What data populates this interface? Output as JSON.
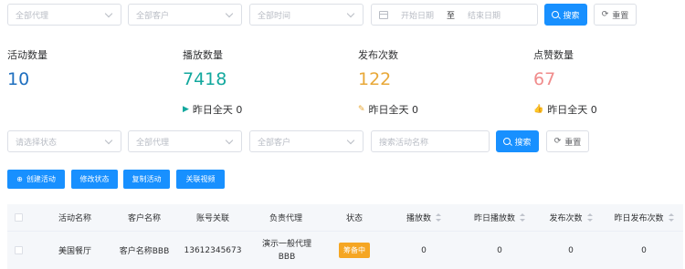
{
  "filters_top": {
    "agent_placeholder": "全部代理",
    "customer_placeholder": "全部客户",
    "time_placeholder": "全部时间",
    "start_date_placeholder": "开始日期",
    "date_separator": "至",
    "end_date_placeholder": "结束日期",
    "search_label": "搜索",
    "reset_label": "重置"
  },
  "stats": {
    "activity_count_label": "活动数量",
    "activity_count_value": "10",
    "play_count_label": "播放数量",
    "play_count_value": "7418",
    "play_yesterday": "昨日全天 0",
    "publish_count_label": "发布次数",
    "publish_count_value": "122",
    "publish_yesterday": "昨日全天 0",
    "like_count_label": "点赞数量",
    "like_count_value": "67",
    "like_yesterday": "昨日全天 0",
    "colors": {
      "activity": "#1f6fbf",
      "play": "#13a89e",
      "publish": "#e8a838",
      "like": "#f08c8c"
    }
  },
  "filters_bottom": {
    "status_placeholder": "请选择状态",
    "agent_placeholder": "全部代理",
    "customer_placeholder": "全部客户",
    "activity_name_placeholder": "搜索活动名称",
    "search_label": "搜索",
    "reset_label": "重置"
  },
  "actions": {
    "create": "创建活动",
    "modify_status": "修改状态",
    "copy": "复制活动",
    "link_video": "关联视频"
  },
  "table": {
    "headers": {
      "name": "活动名称",
      "customer": "客户名称",
      "account": "账号关联",
      "agent": "负责代理",
      "status": "状态",
      "plays": "播放数",
      "yesterday_plays": "昨日播放数",
      "publishes": "发布次数",
      "yesterday_publishes": "昨日发布次数"
    },
    "rows": [
      {
        "name": "美国餐厅",
        "customer": "客户名称BBB",
        "account": "13612345673",
        "agent": "演示一般代理BBB",
        "status": "筹备中",
        "plays": "0",
        "yesterday_plays": "0",
        "publishes": "0",
        "yesterday_publishes": "0"
      }
    ]
  }
}
